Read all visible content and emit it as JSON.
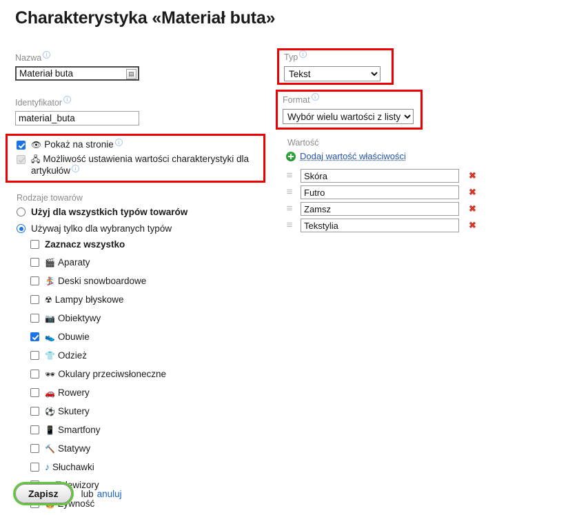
{
  "page_title": "Charakterystyka «Materiał buta»",
  "left": {
    "name": {
      "label": "Nazwa",
      "value": "Materiał buta",
      "lang_button_glyph": "▤"
    },
    "identifier": {
      "label": "Identyfikator",
      "value": "material_buta"
    },
    "options": [
      {
        "icon": "eye-icon",
        "glyph": "👁",
        "label": "Pokaż na stronie",
        "checked": true,
        "disabled": false
      },
      {
        "icon": "sitemap-icon",
        "glyph": "🖧",
        "label": "Możliwość ustawienia wartości charakterystyki dla artykułów",
        "checked": true,
        "disabled": true
      }
    ],
    "kinds_label": "Rodzaje towarów",
    "radios": [
      {
        "label": "Użyj dla wszystkich typów towarów",
        "checked": false,
        "bold": true
      },
      {
        "label": "Używaj tylko dla wybranych typów",
        "checked": true,
        "bold": false
      }
    ],
    "select_all": {
      "label": "Zaznacz wszystko",
      "checked": false
    },
    "types": [
      {
        "glyph": "🎬",
        "icon": "clapper-board-icon",
        "label": "Aparaty",
        "checked": false
      },
      {
        "glyph": "🏂",
        "icon": "snowboard-icon",
        "label": "Deski snowboardowe",
        "checked": false
      },
      {
        "glyph": "☢",
        "icon": "radioactive-icon",
        "label": "Lampy błyskowe",
        "checked": false
      },
      {
        "glyph": "📷",
        "icon": "camera-icon",
        "label": "Obiektywy",
        "checked": false
      },
      {
        "glyph": "👟",
        "icon": "shoe-icon",
        "label": "Obuwie",
        "checked": true
      },
      {
        "glyph": "👕",
        "icon": "tshirt-icon",
        "label": "Odzież",
        "checked": false
      },
      {
        "glyph": "🕶",
        "icon": "sunglasses-icon",
        "label": "Okulary przeciwsłoneczne",
        "checked": false
      },
      {
        "glyph": "🚗",
        "icon": "car-icon",
        "label": "Rowery",
        "checked": false
      },
      {
        "glyph": "⚽",
        "icon": "soccer-ball-icon",
        "label": "Skutery",
        "checked": false
      },
      {
        "glyph": "📱",
        "icon": "mobile-phone-icon",
        "label": "Smartfony",
        "checked": false
      },
      {
        "glyph": "🔨",
        "icon": "hammer-icon",
        "label": "Statywy",
        "checked": false
      },
      {
        "glyph": "♪",
        "icon": "music-note-icon",
        "label": "Słuchawki",
        "checked": false
      },
      {
        "glyph": "🖵",
        "icon": "television-icon",
        "label": "Telewizory",
        "checked": false
      },
      {
        "glyph": "🍔",
        "icon": "hamburger-icon",
        "label": "Żywność",
        "checked": false
      }
    ]
  },
  "right": {
    "type": {
      "label": "Typ",
      "value": "Tekst",
      "options": [
        "Tekst"
      ]
    },
    "format": {
      "label": "Format",
      "value": "Wybór wielu wartości z listy",
      "options": [
        "Wybór wielu wartości z listy"
      ]
    },
    "value_label": "Wartość",
    "add_link": "Dodaj wartość właściwości",
    "values": [
      "Skóra",
      "Futro",
      "Zamsz",
      "Tekstylia"
    ],
    "delete_glyph": "✖",
    "drag_glyph": "≡"
  },
  "footer": {
    "save_label": "Zapisz",
    "or_text": "lub",
    "cancel_label": "anuluj"
  },
  "colors": {
    "highlight": "#ee0000",
    "link": "#2554a8",
    "accent_green": "#2eaa3c",
    "checkbox_blue": "#1a73e8",
    "delete_red": "#cf3a2b"
  }
}
